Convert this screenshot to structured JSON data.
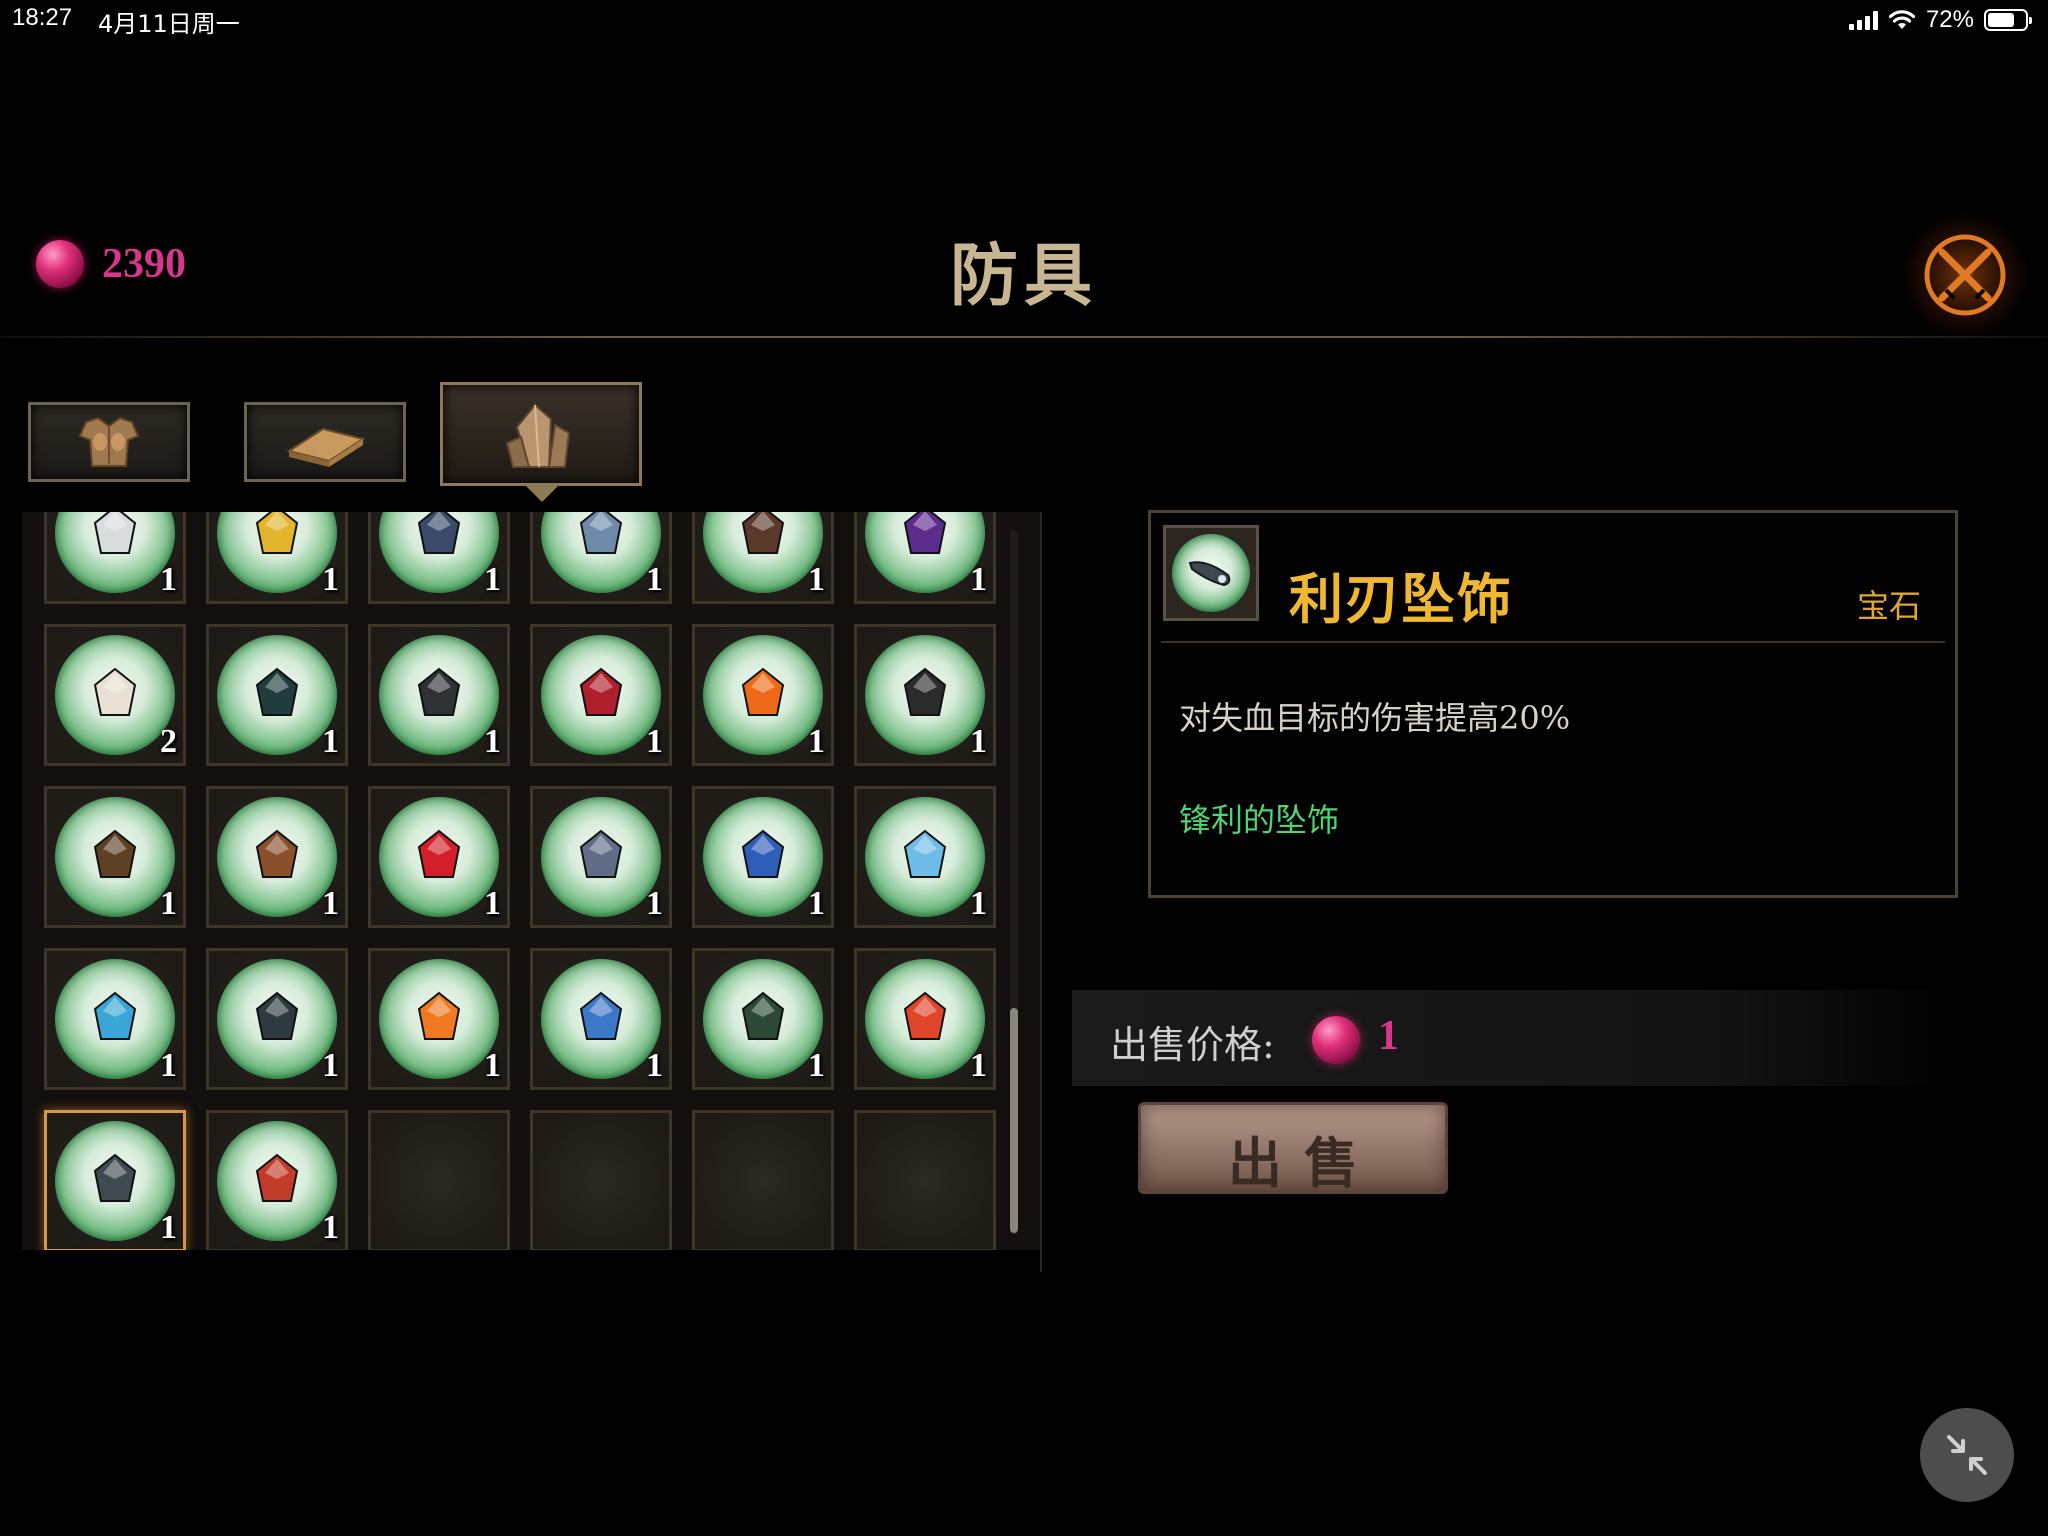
{
  "status_bar": {
    "time": "18:27",
    "date": "4月11日周一",
    "battery": "72%",
    "battery_level": 0.72
  },
  "header": {
    "currency_value": "2390",
    "title": "防具",
    "close_icon": "crossed-swords-close-icon"
  },
  "tabs": [
    {
      "icon": "chest-armor-icon",
      "active": false
    },
    {
      "icon": "ingot-icon",
      "active": false
    },
    {
      "icon": "crystal-gem-icon",
      "active": true
    }
  ],
  "inventory": {
    "rows": [
      [
        {
          "count": "1",
          "color": "#d9dde0"
        },
        {
          "count": "1",
          "color": "#e2b52c"
        },
        {
          "count": "1",
          "color": "#3a4a6a"
        },
        {
          "count": "1",
          "color": "#6f8aa8"
        },
        {
          "count": "1",
          "color": "#5b3a2c"
        },
        {
          "count": "1",
          "color": "#5c2c8c"
        }
      ],
      [
        {
          "count": "2",
          "color": "#e8e1d3"
        },
        {
          "count": "1",
          "color": "#1f3d3d"
        },
        {
          "count": "1",
          "color": "#2f3235"
        },
        {
          "count": "1",
          "color": "#b01f2c"
        },
        {
          "count": "1",
          "color": "#ef6a18"
        },
        {
          "count": "1",
          "color": "#2b2b2b"
        }
      ],
      [
        {
          "count": "1",
          "color": "#5e4025"
        },
        {
          "count": "1",
          "color": "#8a4f2c"
        },
        {
          "count": "1",
          "color": "#d41f2a"
        },
        {
          "count": "1",
          "color": "#5f6e86"
        },
        {
          "count": "1",
          "color": "#2f5eb8"
        },
        {
          "count": "1",
          "color": "#6dbde8"
        }
      ],
      [
        {
          "count": "1",
          "color": "#3aa6d8"
        },
        {
          "count": "1",
          "color": "#2f3a40"
        },
        {
          "count": "1",
          "color": "#f07a22"
        },
        {
          "count": "1",
          "color": "#3c77c8"
        },
        {
          "count": "1",
          "color": "#2a4a35"
        },
        {
          "count": "1",
          "color": "#e0462a"
        }
      ],
      [
        {
          "count": "1",
          "color": "#3e4a4f",
          "selected": true
        },
        {
          "count": "1",
          "color": "#c33b2a"
        },
        {
          "empty": true
        },
        {
          "empty": true
        },
        {
          "empty": true
        },
        {
          "empty": true
        }
      ]
    ]
  },
  "detail": {
    "name": "利刃坠饰",
    "type": "宝石",
    "description": "对失血目标的伤害提高20%",
    "flavor": "锋利的坠饰"
  },
  "sell": {
    "label": "出售价格:",
    "price": "1",
    "button_label": "出售"
  },
  "colors": {
    "gold": "#f0b731",
    "currency": "#d8368a",
    "flavor": "#4fd470",
    "accent_orange": "#d8964a"
  }
}
